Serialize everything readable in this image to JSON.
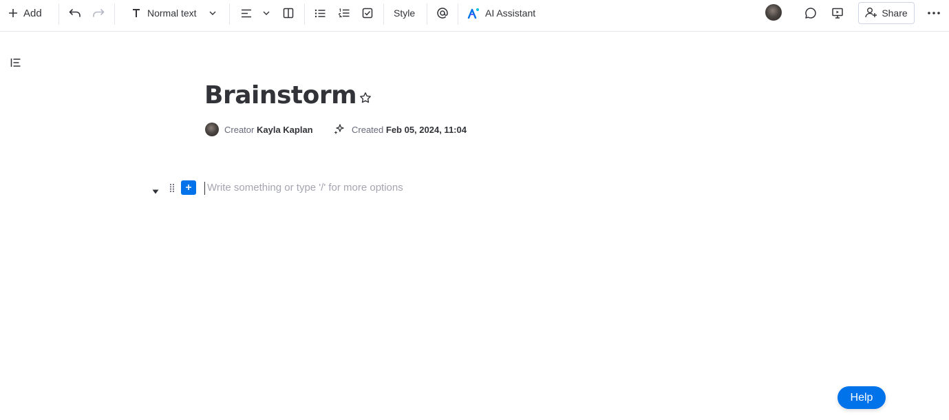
{
  "toolbar": {
    "add_label": "Add",
    "text_style_label": "Normal text",
    "style_label": "Style",
    "ai_label": "AI Assistant",
    "share_label": "Share"
  },
  "document": {
    "title": "Brainstorm",
    "creator_label": "Creator",
    "creator_name": "Kayla Kaplan",
    "created_label": "Created",
    "created_date": "Feb 05, 2024, 11:04"
  },
  "editor": {
    "placeholder": "Write something or type '/' for more options"
  },
  "help_label": "Help",
  "colors": {
    "accent": "#0073ea",
    "text": "#323338",
    "muted": "#676879",
    "placeholder": "#a4a5b0",
    "border": "#e6e7ec"
  },
  "icons": [
    "plus-icon",
    "undo-icon",
    "redo-icon",
    "text-type-icon",
    "chevron-down-icon",
    "align-left-icon",
    "columns-icon",
    "bullet-list-icon",
    "numbered-list-icon",
    "checklist-icon",
    "mention-icon",
    "ai-assistant-icon",
    "comment-icon",
    "present-icon",
    "add-person-icon",
    "more-icon",
    "table-of-contents-icon",
    "star-icon",
    "sparkle-icon",
    "caret-down-icon",
    "drag-handle-icon"
  ]
}
